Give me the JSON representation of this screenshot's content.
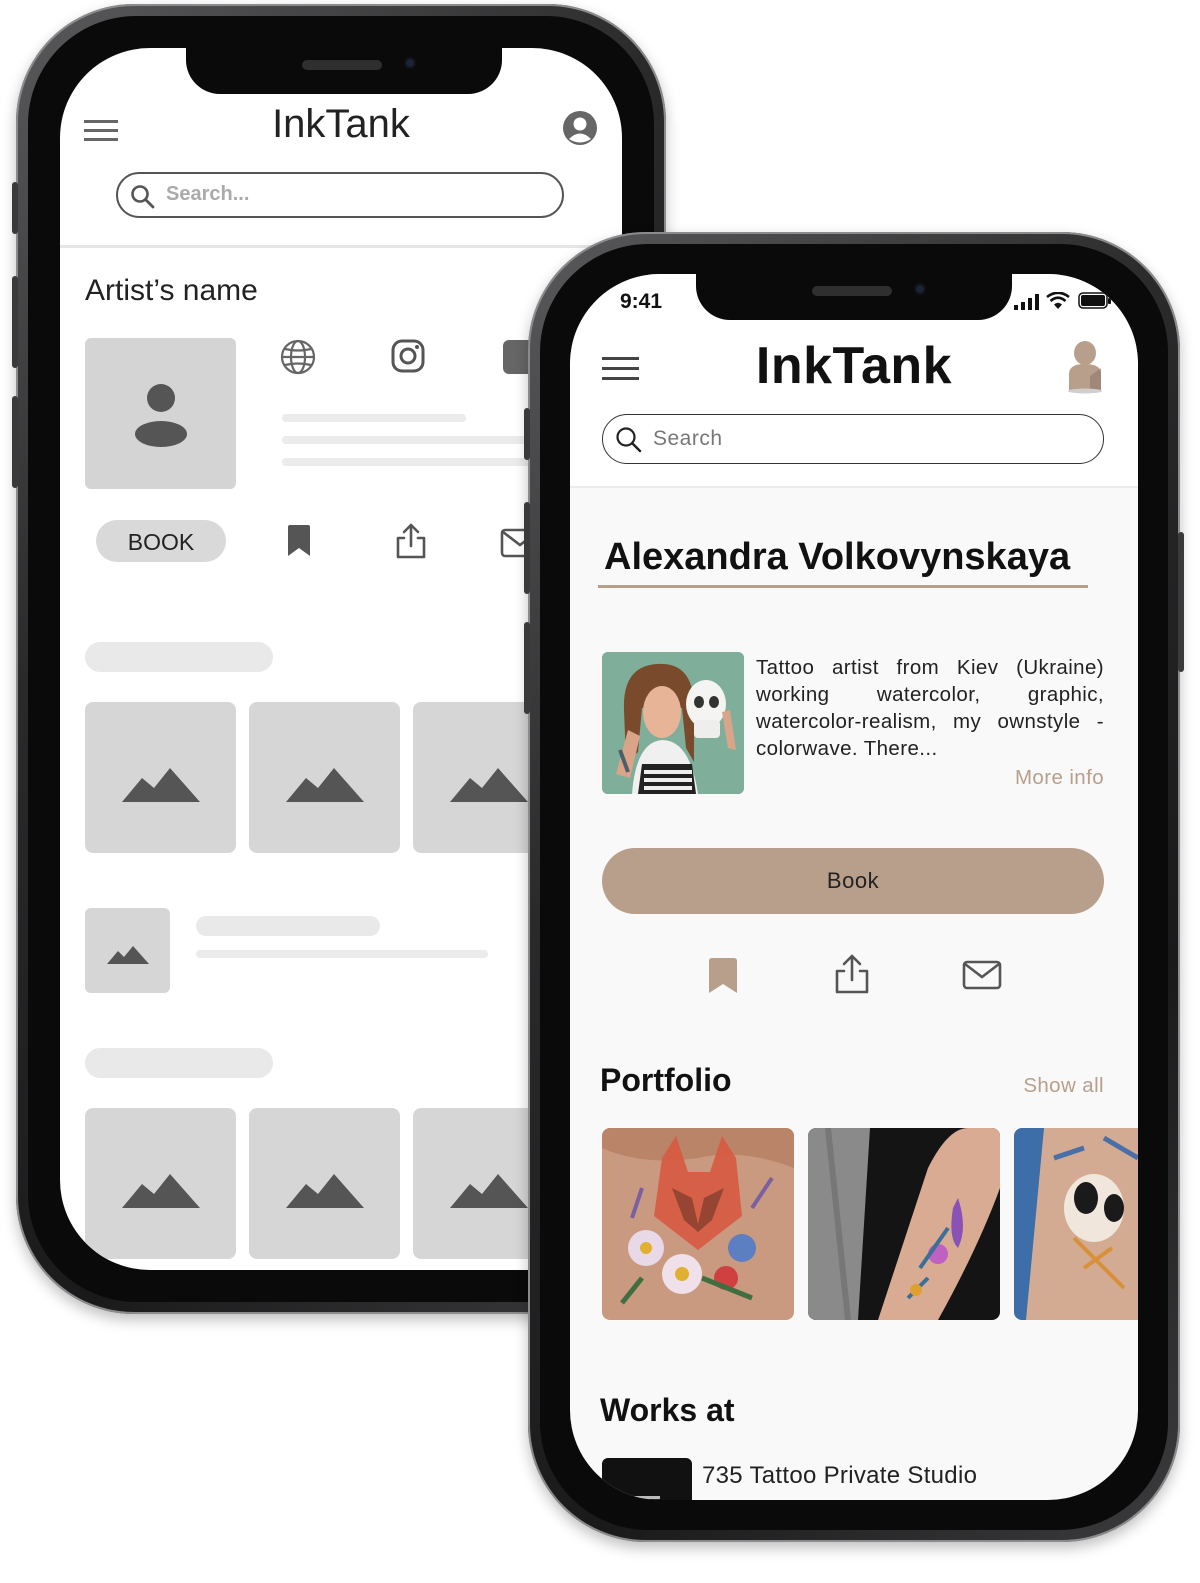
{
  "wireframe": {
    "app_title": "InkTank",
    "search_placeholder": "Search...",
    "artist_name": "Artist’s name",
    "book_label": "BOOK"
  },
  "app": {
    "status_time": "9:41",
    "title": "InkTank",
    "search_placeholder": "Search",
    "artist": {
      "name": "Alexandra Volkovynskaya",
      "bio": "Tattoo artist from Kiev (Ukraine) working watercolor, graphic, watercolor-realism, my ownstyle - colorwave. There...",
      "more_info": "More info"
    },
    "book_label": "Book",
    "portfolio": {
      "heading": "Portfolio",
      "show_all": "Show all"
    },
    "works_at": {
      "heading": "Works at",
      "studio": "735 Tattoo Private Studio"
    },
    "colors": {
      "accent": "#b89f8c",
      "text": "#111111"
    }
  }
}
